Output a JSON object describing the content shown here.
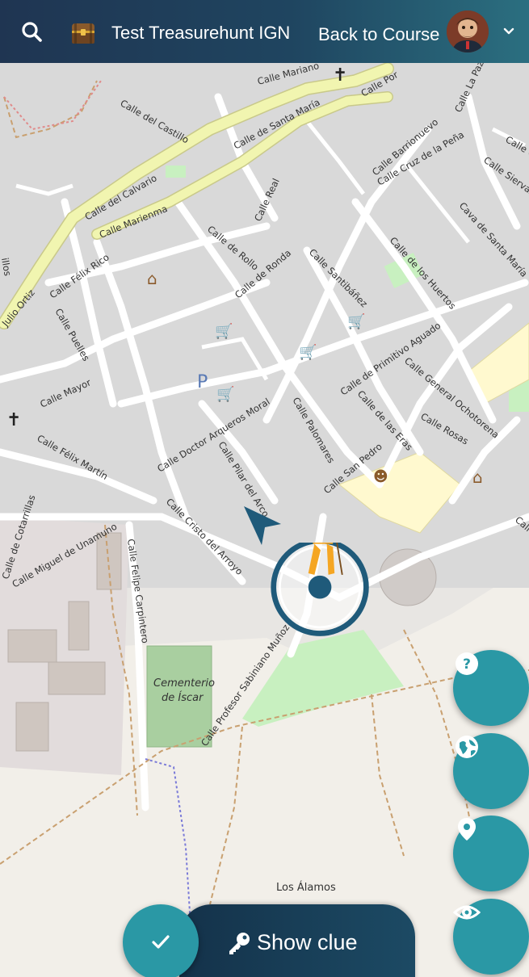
{
  "header": {
    "search_icon": "search-icon",
    "chest_icon": "treasure-chest-icon",
    "title": "Test Treasurehunt IGN",
    "back_label": "Back to Course",
    "avatar": "user-avatar",
    "chevron_icon": "chevron-down-icon"
  },
  "map": {
    "street_labels": {
      "calle_mariano": "Calle Mariano",
      "calle_portillo": "Calle Por",
      "calle_del_castillo": "Calle del Castillo",
      "calle_de_santa_maria": "Calle de Santa María",
      "calle_del_calvario": "Calle del Calvario",
      "calle_marienma": "Calle Marienma",
      "calle_real": "Calle Real",
      "calle_barrionuevo": "Calle Barrionuevo",
      "calle_cruz_de_la_pena": "Calle Cruz de la Peña",
      "calle_la_paz": "Calle La Paz",
      "calle_c": "Calle C",
      "calle_sierva": "Calle Siervas",
      "cava_de_santa_maria": "Cava de Santa María",
      "calle_felix_rico": "Calle Félix Rico",
      "julio_ortiz": "Julio Ortiz",
      "calle_de_rollo": "Calle de Rollo",
      "calle_de_ronda": "Calle de Ronda",
      "calle_santibanez": "Calle Santibáñez",
      "calle_de_los_huertos": "Calle de los Huertos",
      "calle_puelles": "Calle Puelles",
      "calle_mayor": "Calle Mayor",
      "calle_de_primitivo_aguado": "Calle de Primitivo Aguado",
      "calle_general_ochotorena": "Calle General Ochotorena",
      "calle_felix_martin": "Calle Félix Martín",
      "calle_doctor_arqueros_moral": "Calle Doctor Arqueros Moral",
      "calle_palomares": "Calle Palomares",
      "calle_de_las_eras": "Calle de las Eras",
      "calle_rosas": "Calle Rosas",
      "calle_pilar_del_arco": "Calle Pilar del Arco",
      "calle_san_pedro": "Calle San Pedro",
      "calle_de_cotarrillas": "Calle de Cotarrillas",
      "calle_miguel_de_unamuno": "Calle Miguel de Unamuno",
      "calle_cristo_del_arroyo": "Calle Cristo del Arroyo",
      "calle_felipe_carpintero": "Calle Felipe Carpintero",
      "calle_profesor_sabiniano_munoz": "Calle Profesor Sabiniano Muñoz",
      "calle_cal": "Calle",
      "calle_ill": "illos"
    },
    "poi_labels": {
      "cementerio_line1": "Cementerio",
      "cementerio_line2": "de Íscar",
      "los_alamos": "Los Álamos"
    }
  },
  "fabs": {
    "help": "help-icon",
    "globe": "globe-icon",
    "location": "location-pin-icon",
    "visibility": "eye-icon"
  },
  "bottom": {
    "check_icon": "check-icon",
    "key_icon": "key-icon",
    "clue_label": "Show clue"
  },
  "colors": {
    "header_start": "#1f3552",
    "header_end": "#2b6f80",
    "fab": "#2a98a5",
    "clue_bg": "#14324a",
    "marker_ring": "#1f5a7a",
    "main_road": "#f1f5b0"
  }
}
